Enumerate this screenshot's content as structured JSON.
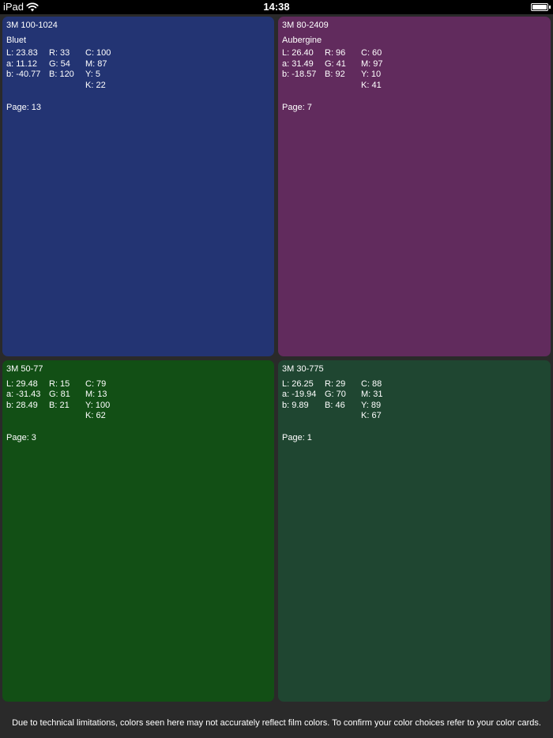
{
  "statusbar": {
    "device": "iPad",
    "time": "14:38",
    "battery_level": 1.0
  },
  "swatches": [
    {
      "code": "3M 100-1024",
      "name": "Bluet",
      "color": "#233473",
      "lab": [
        "L: 23.83",
        "a: 11.12",
        "b: -40.77"
      ],
      "rgb": [
        "R: 33",
        "G: 54",
        "B: 120"
      ],
      "cmyk": [
        "C: 100",
        "M: 87",
        "Y: 5",
        "K: 22"
      ],
      "page": "Page: 13"
    },
    {
      "code": "3M 80-2409",
      "name": "Aubergine",
      "color": "#612b5d",
      "lab": [
        "L: 26.40",
        "a: 31.49",
        "b: -18.57"
      ],
      "rgb": [
        "R: 96",
        "G: 41",
        "B: 92"
      ],
      "cmyk": [
        "C: 60",
        "M: 97",
        "Y: 10",
        "K: 41"
      ],
      "page": "Page: 7"
    },
    {
      "code": "3M 50-77",
      "name": "",
      "color": "#124f15",
      "lab": [
        "L: 29.48",
        "a: -31.43",
        "b: 28.49"
      ],
      "rgb": [
        "R: 15",
        "G: 81",
        "B: 21"
      ],
      "cmyk": [
        "C: 79",
        "M: 13",
        "Y: 100",
        "K: 62"
      ],
      "page": "Page: 3"
    },
    {
      "code": "3M 30-775",
      "name": "",
      "color": "#1f4631",
      "lab": [
        "L: 26.25",
        "a: -19.94",
        "b: 9.89"
      ],
      "rgb": [
        "R: 29",
        "G: 70",
        "B: 46"
      ],
      "cmyk": [
        "C: 88",
        "M: 31",
        "Y: 89",
        "K: 67"
      ],
      "page": "Page: 1"
    }
  ],
  "disclaimer": "Due to technical limitations, colors seen here may not accurately reflect film colors. To confirm your color choices refer to your color cards."
}
